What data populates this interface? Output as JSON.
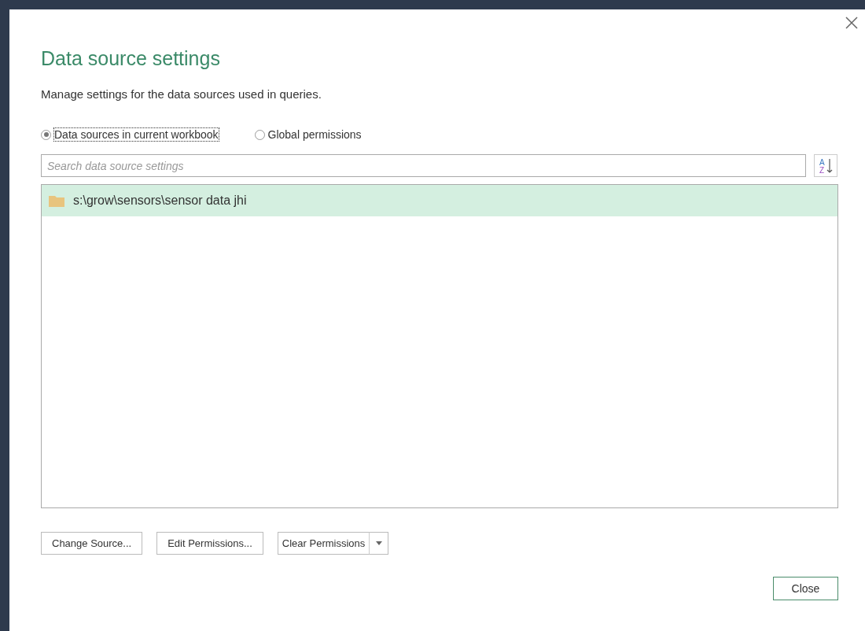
{
  "dialog": {
    "title": "Data source settings",
    "description": "Manage settings for the data sources used in queries."
  },
  "scope": [
    {
      "label": "Data sources in current workbook",
      "selected": true
    },
    {
      "label": "Global permissions",
      "selected": false
    }
  ],
  "search": {
    "placeholder": "Search data source settings"
  },
  "sort_button": {
    "letters": [
      "A",
      "Z"
    ]
  },
  "sources": [
    {
      "path": "s:\\grow\\sensors\\sensor data jhi",
      "selected": true
    }
  ],
  "buttons": [
    "Change Source...",
    "Edit Permissions..."
  ],
  "split_button": {
    "label": "Clear Permissions"
  },
  "close_button": "Close"
}
